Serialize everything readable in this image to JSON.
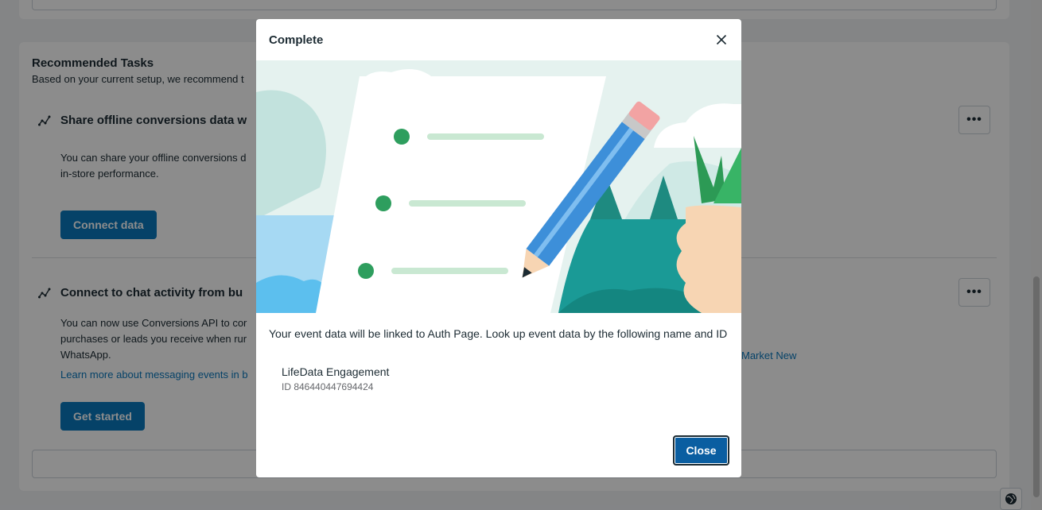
{
  "background": {
    "section_title": "Recommended Tasks",
    "section_subtitle": "Based on your current setup, we recommend t",
    "tasks": [
      {
        "title": "Share offline conversions data w",
        "description": "You can share your offline conversions d\nin-store performance.",
        "button_label": "Connect data",
        "more_label": "•••",
        "icon": "chart-trend-icon"
      },
      {
        "title": "Connect to chat activity from bu",
        "description": "You can now use Conversions API to cor\npurchases or leads you receive when rur\nWhatsApp.",
        "link": "Learn more about messaging events in b",
        "side_link": "Market New",
        "button_label": "Get started",
        "more_label": "•••",
        "icon": "chart-trend-icon"
      }
    ]
  },
  "modal": {
    "title": "Complete",
    "message": "Your event data will be linked to Auth Page. Look up event data by the following name and ID",
    "event_name": "LifeData Engagement",
    "event_id": "ID 846440447694424",
    "close_button": "Close",
    "close_icon": "close-icon",
    "illustration": "checklist-pencil-illustration"
  },
  "colors": {
    "primary": "#0a78be",
    "primary_dark": "#0a5ea1",
    "link": "#0a78be",
    "teal": "#1a9a96",
    "green_dot": "#2e9e5e",
    "pencil_blue": "#3d8fd9",
    "skin": "#f7d5b3"
  }
}
